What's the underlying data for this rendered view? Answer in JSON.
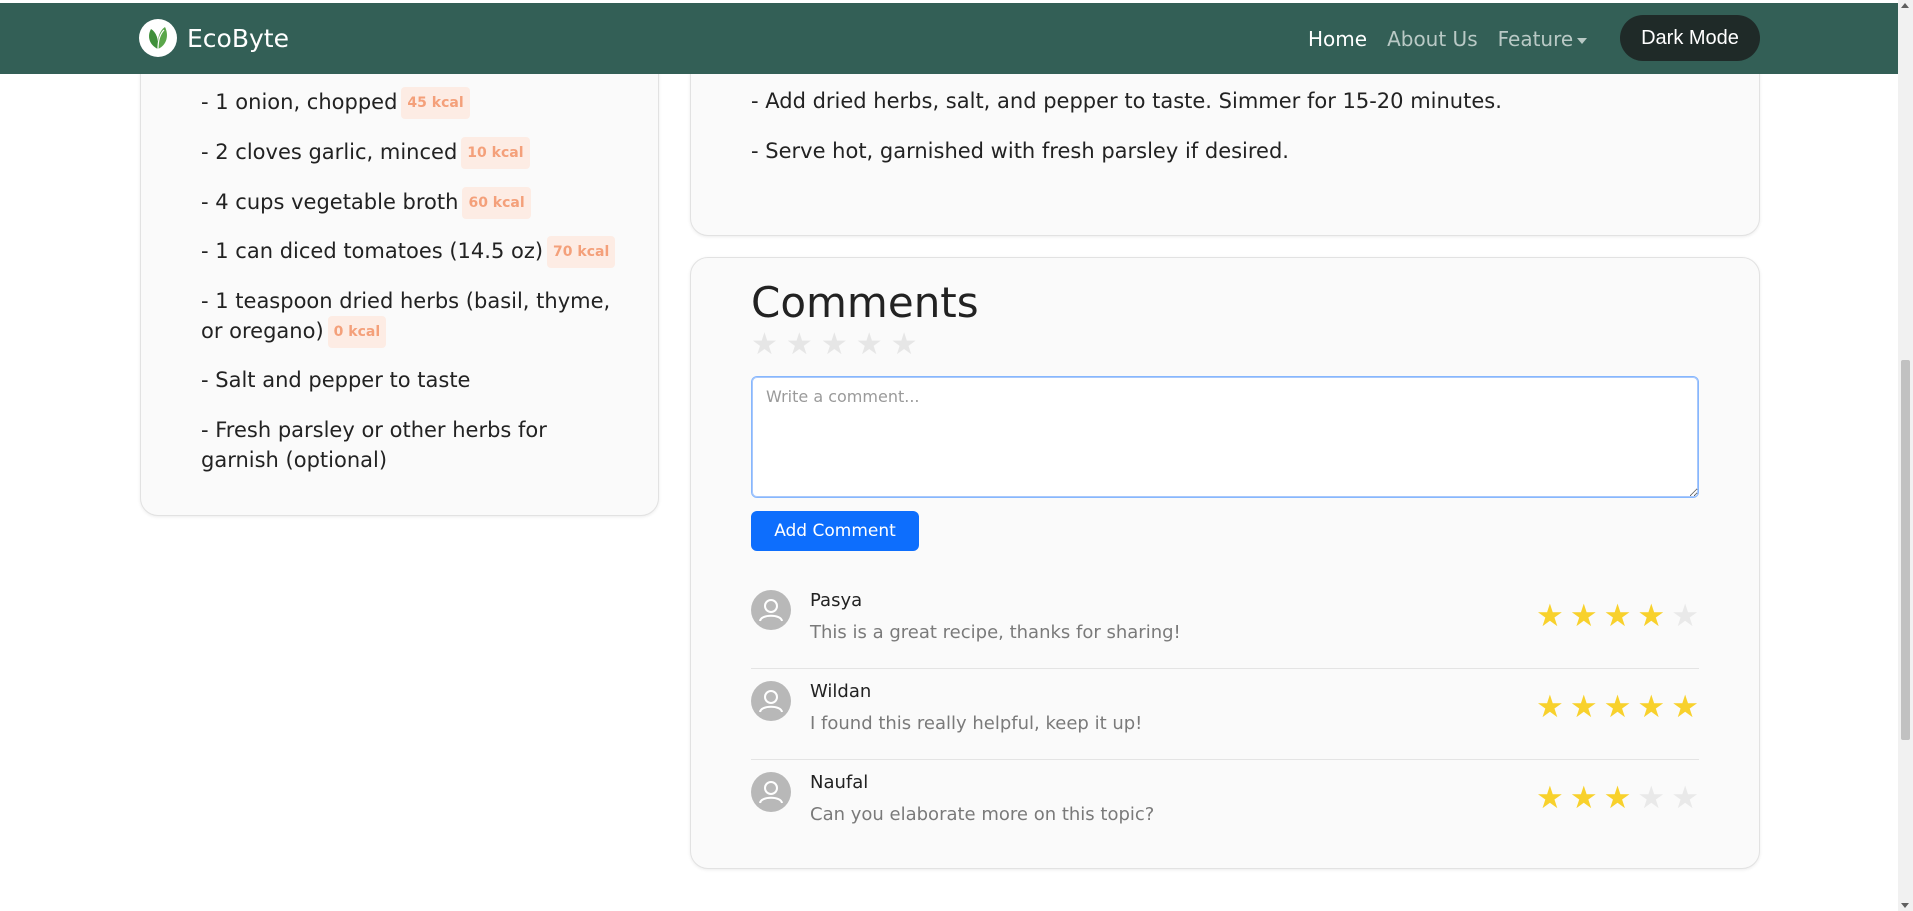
{
  "navbar": {
    "brand": "EcoByte",
    "links": [
      "Home",
      "About Us",
      "Feature"
    ],
    "dark_mode_label": "Dark Mode",
    "bg_color": "#335f56"
  },
  "ingredients": [
    {
      "text": "- 1 onion, chopped",
      "kcal": "45 kcal"
    },
    {
      "text": "- 2 cloves garlic, minced",
      "kcal": "10 kcal"
    },
    {
      "text": "- 4 cups vegetable broth",
      "kcal": "60 kcal"
    },
    {
      "text": "- 1 can diced tomatoes (14.5 oz)",
      "kcal": "70 kcal"
    },
    {
      "text_line1": "- 1 teaspoon dried herbs (basil, thyme,",
      "text_line2": "or oregano)",
      "kcal": "0 kcal"
    },
    {
      "text": "- Salt and pepper to taste"
    },
    {
      "text_line1": "- Fresh parsley or other herbs for",
      "text_line2": "garnish (optional)"
    }
  ],
  "instructions": [
    "- Add dried herbs, salt, and pepper to taste. Simmer for 15-20 minutes.",
    "- Serve hot, garnished with fresh parsley if desired."
  ],
  "comments_section": {
    "title": "Comments",
    "rating_value": 0,
    "rating_max": 5,
    "placeholder": "Write a comment...",
    "add_button_label": "Add Comment",
    "comments": [
      {
        "name": "Pasya",
        "text": "This is a great recipe, thanks for sharing!",
        "rating": 4
      },
      {
        "name": "Wildan",
        "text": "I found this really helpful, keep it up!",
        "rating": 5
      },
      {
        "name": "Naufal",
        "text": "Can you elaborate more on this topic?",
        "rating": 3
      }
    ]
  },
  "colors": {
    "accent_blue": "#0d6efd",
    "star_active": "#f8d12c",
    "kcal_text": "#f4a07a"
  }
}
